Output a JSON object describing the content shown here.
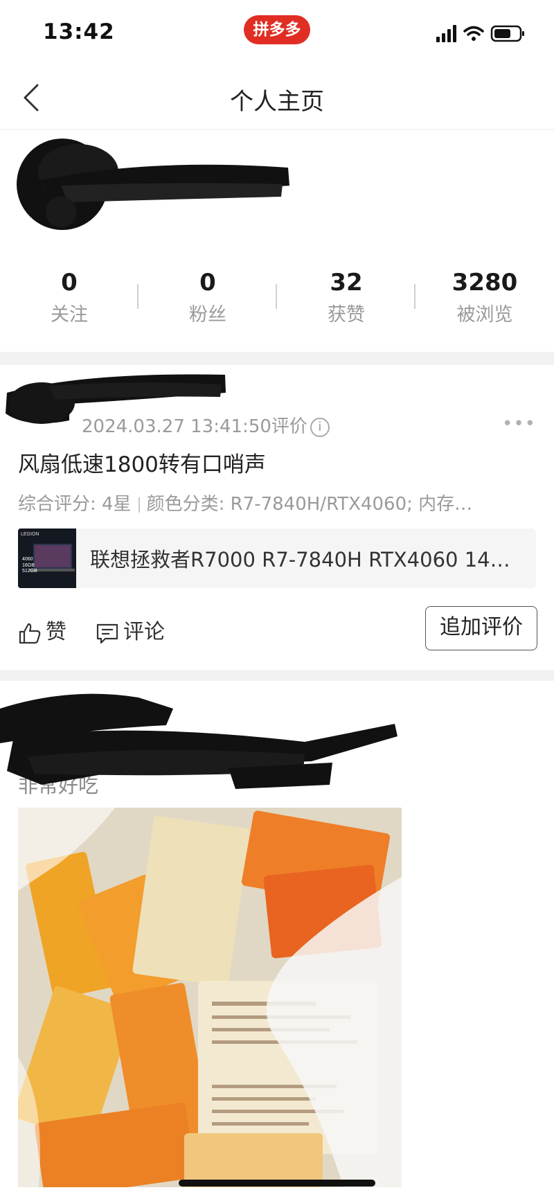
{
  "status_bar": {
    "time": "13:42",
    "app_badge": "拼多多"
  },
  "nav": {
    "title": "个人主页"
  },
  "profile": {
    "stats": [
      {
        "value": "0",
        "label": "关注"
      },
      {
        "value": "0",
        "label": "粉丝"
      },
      {
        "value": "32",
        "label": "获赞"
      },
      {
        "value": "3280",
        "label": "被浏览"
      }
    ]
  },
  "review1": {
    "date": "2024.03.27 13:41:50评价",
    "text": "风扇低速1800转有口哨声",
    "spec_rating": "综合评分: 4星",
    "spec_color": "颜色分类: R7-7840H/RTX4060; 内存…",
    "product": {
      "name": "联想拯救者R7000 R7-7840H RTX4060 14…",
      "thumb_brand": "LEGION",
      "thumb_gpu": "4060",
      "thumb_ram": "16GB",
      "thumb_ssd": "512GB"
    },
    "like_label": "赞",
    "comment_label": "评论",
    "add_review_label": "追加评价"
  },
  "review2": {
    "text_partial": "非常好吃"
  },
  "colors": {
    "brand_red": "#e02e24",
    "muted_text": "#9a9a9a"
  }
}
